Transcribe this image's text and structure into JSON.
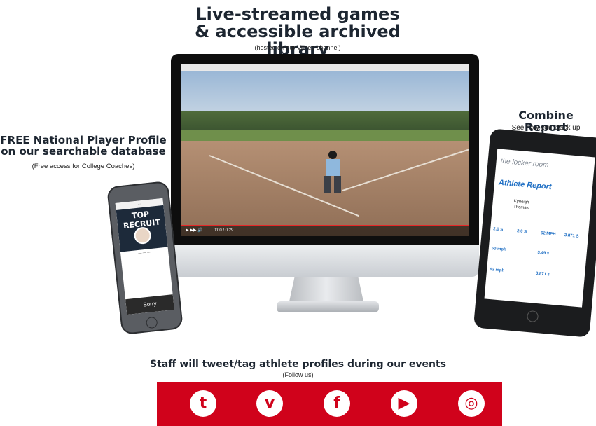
{
  "top_heading": {
    "line1": "Live-streamed games",
    "line2": "& accessible archived library",
    "subtitle": "(hosted on our Vimeo channel)"
  },
  "left_caption": {
    "line1": "FREE National Player Profile",
    "line2": "on our searchable database",
    "subtitle": "(Free access for College Coaches)"
  },
  "right_caption": {
    "title": "Combine Report",
    "subtitle": "See how you stack up"
  },
  "video": {
    "time": "0:00 / 0:29"
  },
  "tablet": {
    "brand": "the locker room",
    "report_title": "Athlete Report",
    "athlete_first": "Kyrleigh",
    "athlete_last": "Thomas",
    "stats": [
      "2.0 S",
      "2.0 S",
      "62 MPH",
      "3.871 S",
      "60 mph",
      "3.49 s",
      "62 mph",
      "3.871 s"
    ]
  },
  "phone": {
    "logo": "TOP RECRUIT",
    "footer": "Sorry"
  },
  "bottom": {
    "title": "Staff will tweet/tag athlete profiles during our events",
    "subtitle": "(Follow us)"
  },
  "social_icons": [
    "twitter-icon",
    "vimeo-icon",
    "facebook-icon",
    "youtube-icon",
    "instagram-icon"
  ],
  "colors": {
    "brand_red": "#d0021b",
    "heading_dark": "#1d2631",
    "report_blue": "#1f6fc4"
  }
}
